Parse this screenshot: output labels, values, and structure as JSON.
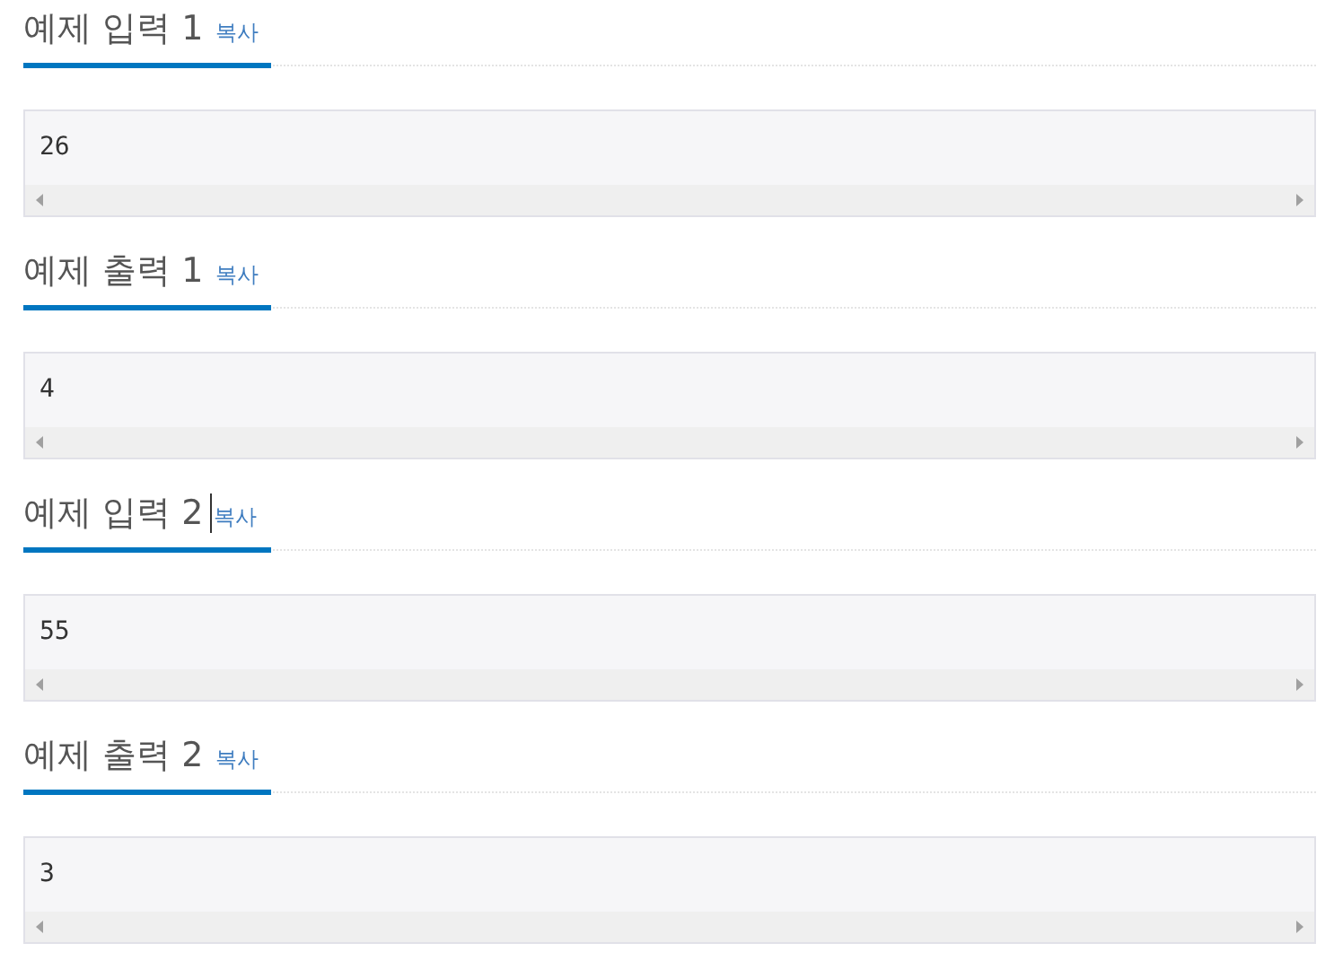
{
  "samples": [
    {
      "title": "예제 입력 1",
      "copy": "복사",
      "text_cursor": false,
      "value": "26"
    },
    {
      "title": "예제 출력 1",
      "copy": "복사",
      "text_cursor": false,
      "value": "4"
    },
    {
      "title": "예제 입력 2",
      "copy": "복사",
      "text_cursor": true,
      "value": "55"
    },
    {
      "title": "예제 출력 2",
      "copy": "복사",
      "text_cursor": false,
      "value": "3"
    }
  ]
}
